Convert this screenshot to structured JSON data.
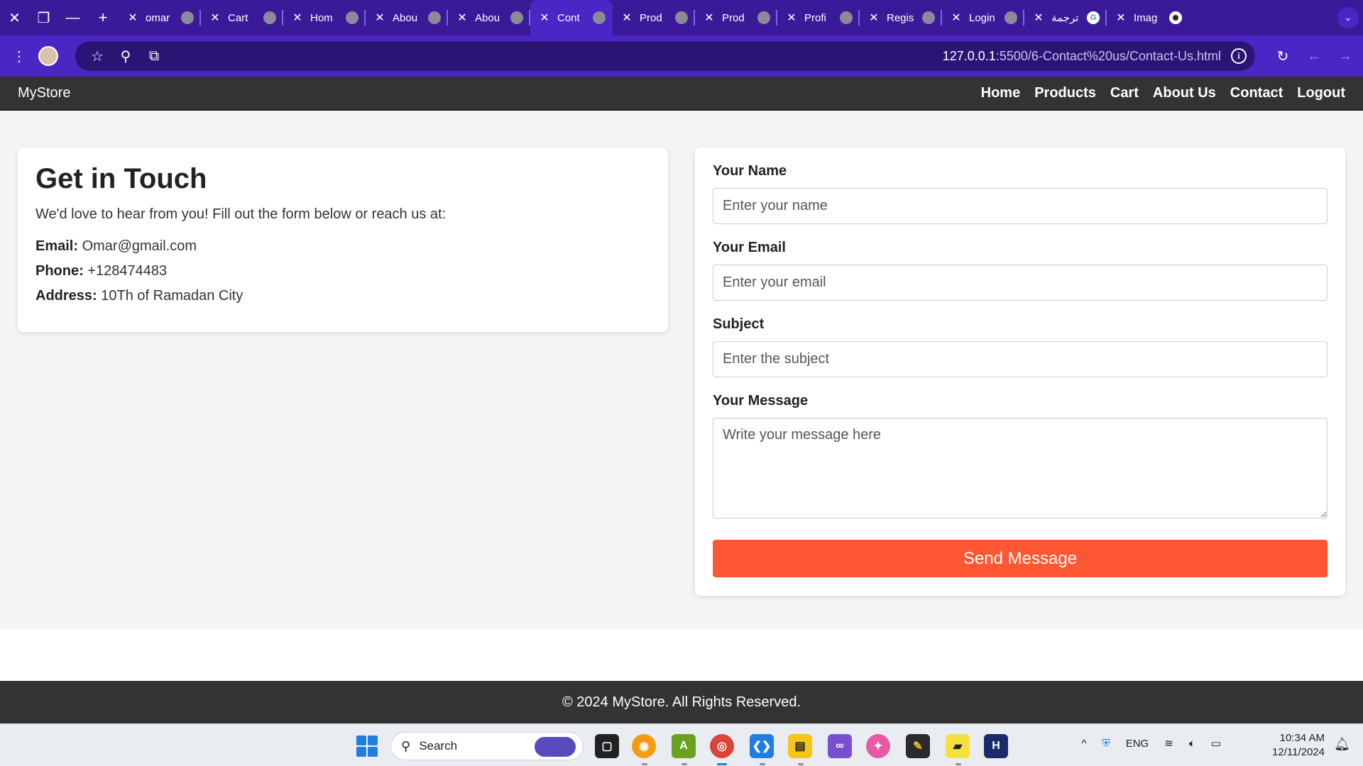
{
  "browser": {
    "tabs": [
      {
        "title": "omar",
        "icon": "github-icon"
      },
      {
        "title": "Cart",
        "icon": "globe-icon"
      },
      {
        "title": "Hom",
        "icon": "globe-icon"
      },
      {
        "title": "Abou",
        "icon": "globe-icon"
      },
      {
        "title": "Abou",
        "icon": "globe-icon"
      },
      {
        "title": "Cont",
        "icon": "globe-icon",
        "active": true
      },
      {
        "title": "Prod",
        "icon": "globe-icon"
      },
      {
        "title": "Prod",
        "icon": "globe-icon"
      },
      {
        "title": "Profi",
        "icon": "globe-icon"
      },
      {
        "title": "Regis",
        "icon": "globe-icon"
      },
      {
        "title": "Login",
        "icon": "globe-icon"
      },
      {
        "title": "ترجمة",
        "icon": "google-icon"
      },
      {
        "title": "Imag",
        "icon": "chatgpt-icon"
      }
    ],
    "url_host": "127.0.0.1",
    "url_path": ":5500/6-Contact%20us/Contact-Us.html",
    "colors": {
      "tabbar": "#3b1a9a",
      "toolbar": "#4a26c4"
    }
  },
  "site": {
    "brand": "MyStore",
    "nav": [
      "Home",
      "Products",
      "Cart",
      "About Us",
      "Contact",
      "Logout"
    ],
    "footer": "© 2024 MyStore. All Rights Reserved."
  },
  "contact": {
    "heading": "Get in Touch",
    "intro": "We'd love to hear from you! Fill out the form below or reach us at:",
    "email_label": "Email:",
    "email": "Omar@gmail.com",
    "phone_label": "Phone:",
    "phone": "+128474483",
    "address_label": "Address:",
    "address": "10Th of Ramadan City"
  },
  "form": {
    "name_label": "Your Name",
    "name_placeholder": "Enter your name",
    "email_label": "Your Email",
    "email_placeholder": "Enter your email",
    "subject_label": "Subject",
    "subject_placeholder": "Enter the subject",
    "message_label": "Your Message",
    "message_placeholder": "Write your message here",
    "submit": "Send Message",
    "accent_color": "#ff5733"
  },
  "taskbar": {
    "search": "Search",
    "lang": "ENG",
    "time": "10:34 AM",
    "date": "12/11/2024"
  }
}
